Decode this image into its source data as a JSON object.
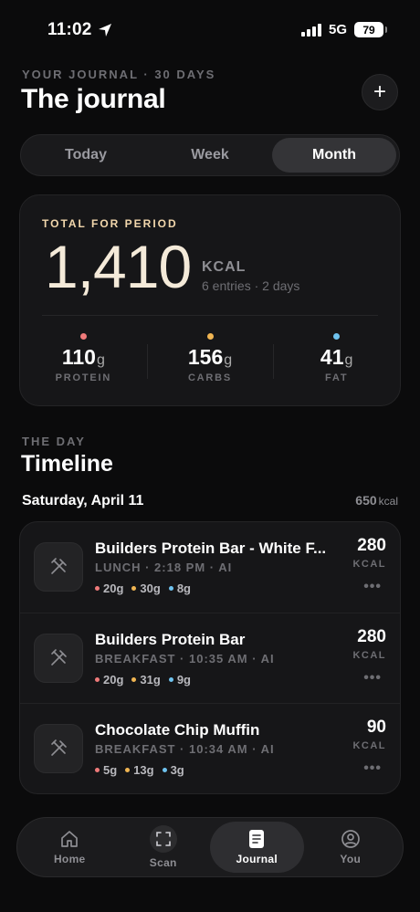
{
  "status": {
    "time": "11:02",
    "network": "5G",
    "battery": "79"
  },
  "header": {
    "eyebrow": "YOUR JOURNAL · 30 DAYS",
    "title": "The journal",
    "add_label": "+"
  },
  "segments": [
    {
      "label": "Today",
      "active": false
    },
    {
      "label": "Week",
      "active": false
    },
    {
      "label": "Month",
      "active": true
    }
  ],
  "summary": {
    "eyebrow": "TOTAL FOR PERIOD",
    "total": "1,410",
    "unit": "KCAL",
    "sub": "6 entries · 2 days",
    "macros": [
      {
        "value": "110",
        "unit": "g",
        "label": "PROTEIN",
        "color": "#ef7a7a"
      },
      {
        "value": "156",
        "unit": "g",
        "label": "CARBS",
        "color": "#f0b552"
      },
      {
        "value": "41",
        "unit": "g",
        "label": "FAT",
        "color": "#6fc3ef"
      }
    ]
  },
  "timeline": {
    "eyebrow": "THE DAY",
    "title": "Timeline",
    "day_label": "Saturday, April 11",
    "day_total": "650",
    "day_total_unit": "kcal",
    "entries": [
      {
        "name": "Builders Protein Bar - White F...",
        "meta": "LUNCH · 2:18 PM  ·  AI",
        "kcal": "280",
        "kcal_unit": "KCAL",
        "protein": "20g",
        "carbs": "30g",
        "fat": "8g",
        "more": "•••"
      },
      {
        "name": "Builders Protein Bar",
        "meta": "BREAKFAST · 10:35 AM  ·  AI",
        "kcal": "280",
        "kcal_unit": "KCAL",
        "protein": "20g",
        "carbs": "31g",
        "fat": "9g",
        "more": "•••"
      },
      {
        "name": "Chocolate Chip Muffin",
        "meta": "BREAKFAST · 10:34 AM  ·  AI",
        "kcal": "90",
        "kcal_unit": "KCAL",
        "protein": "5g",
        "carbs": "13g",
        "fat": "3g",
        "more": "•••"
      }
    ]
  },
  "tabs": [
    {
      "label": "Home",
      "icon": "home-icon",
      "active": false
    },
    {
      "label": "Scan",
      "icon": "scan-icon",
      "active": false
    },
    {
      "label": "Journal",
      "icon": "journal-icon",
      "active": true
    },
    {
      "label": "You",
      "icon": "profile-icon",
      "active": false
    }
  ],
  "colors": {
    "accent_cream": "#f4ead9",
    "protein": "#ef7a7a",
    "carbs": "#f0b552",
    "fat": "#6fc3ef"
  }
}
